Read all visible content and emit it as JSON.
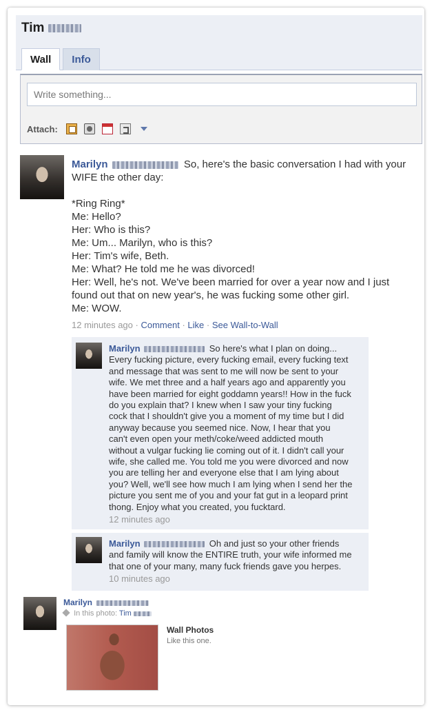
{
  "profile": {
    "name": "Tim"
  },
  "tabs": [
    {
      "label": "Wall"
    },
    {
      "label": "Info"
    }
  ],
  "composer": {
    "placeholder": "Write something...",
    "attach_label": "Attach:"
  },
  "post": {
    "author": "Marilyn",
    "lines": [
      "So, here's the basic conversation I had with your",
      "WIFE the other day:",
      "",
      "*Ring Ring*",
      "Me: Hello?",
      "Her: Who is this?",
      "Me: Um... Marilyn, who is this?",
      "Her: Tim's wife, Beth.",
      "Me: What? He told me he was divorced!",
      "Her: Well, he's not. We've been married for over a year now and I just",
      "found out that on new year's, he was fucking some other girl.",
      "Me: WOW."
    ],
    "time": "12 minutes ago",
    "actions": [
      "Comment",
      "Like",
      "See Wall-to-Wall"
    ]
  },
  "comments": [
    {
      "author": "Marilyn",
      "lines": [
        "So here's what I plan on doing...",
        "Every fucking picture, every fucking email, every fucking text",
        "and message that was sent to me will now be sent to your",
        "wife. We met three and a half years ago and apparently you",
        "have been married for eight goddamn years!! How in the fuck",
        "do you explain that? I knew when I saw your tiny fucking",
        "cock that I shouldn't give you a moment of my time but I did",
        "anyway because you seemed nice. Now, I hear that you",
        "can't even open your meth/coke/weed addicted mouth",
        "without a vulgar fucking lie coming out of it. I didn't call your",
        "wife, she called me. You told me you were divorced and now",
        "you are telling her and everyone else that I am lying about",
        "you? Well, we'll see how much I am lying when I send her the",
        "picture you sent me of you and your fat gut in a leopard print",
        "thong. Enjoy what you created, you fucktard."
      ],
      "time": "12 minutes ago"
    },
    {
      "author": "Marilyn",
      "lines": [
        "Oh and just so your other friends",
        "and family will know the ENTIRE truth, your wife informed me",
        "that one of your many, many fuck friends gave you herpes."
      ],
      "time": "10 minutes ago"
    }
  ],
  "photo_post": {
    "author": "Marilyn",
    "in_photo_label": "In this photo:",
    "tagged": "Tim",
    "album": "Wall Photos",
    "caption": "Like this one."
  }
}
